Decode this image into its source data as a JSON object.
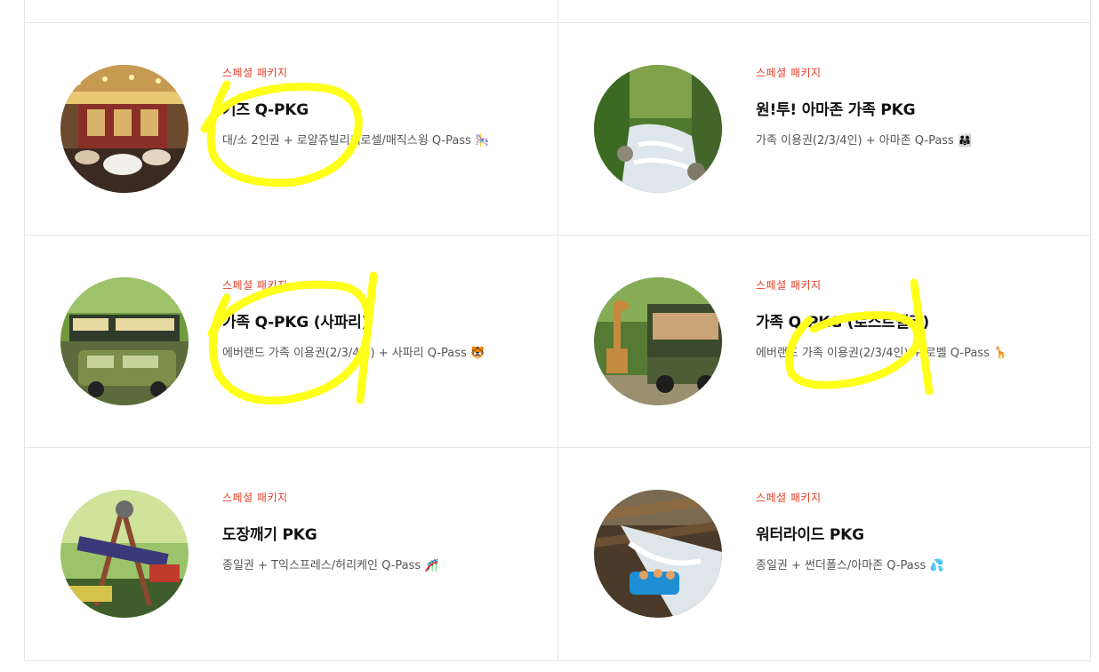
{
  "packages": [
    {
      "eyebrow": "스페셜 패키지",
      "title": "키즈 Q-PKG",
      "desc": "대/소 2인권 + 로얄쥬빌리캐로셀/매직스윙 Q-Pass",
      "emoji": "🎠",
      "image": "carousel-photo"
    },
    {
      "eyebrow": "스페셜 패키지",
      "title": "원!투! 아마존 가족 PKG",
      "desc": "가족 이용권(2/3/4인) + 아마존 Q-Pass",
      "emoji": "👨‍👩‍👧",
      "image": "rapids-photo"
    },
    {
      "eyebrow": "스페셜 패키지",
      "title": "가족 Q-PKG (사파리)",
      "desc": "에버랜드 가족 이용권(2/3/4인) + 사파리 Q-Pass",
      "emoji": "🐯",
      "image": "safari-photo"
    },
    {
      "eyebrow": "스페셜 패키지",
      "title": "가족 Q-PKG (로스트밸리)",
      "desc": "에버랜드 가족 이용권(2/3/4인) + 로벨 Q-Pass",
      "emoji": "🦒",
      "image": "lost-valley-photo"
    },
    {
      "eyebrow": "스페셜 패키지",
      "title": "도장깨기 PKG",
      "desc": "종일권 + T익스프레스/허리케인 Q-Pass",
      "emoji": "🎢",
      "image": "hurricane-ride-photo"
    },
    {
      "eyebrow": "스페셜 패키지",
      "title": "워터라이드 PKG",
      "desc": "종일권 + 썬더폴스/아마존 Q-Pass",
      "emoji": "💦",
      "image": "water-ride-photo"
    }
  ],
  "colors": {
    "eyebrow": "#e4412b",
    "highlight": "#ffff1a",
    "border": "#e6e6e6"
  }
}
